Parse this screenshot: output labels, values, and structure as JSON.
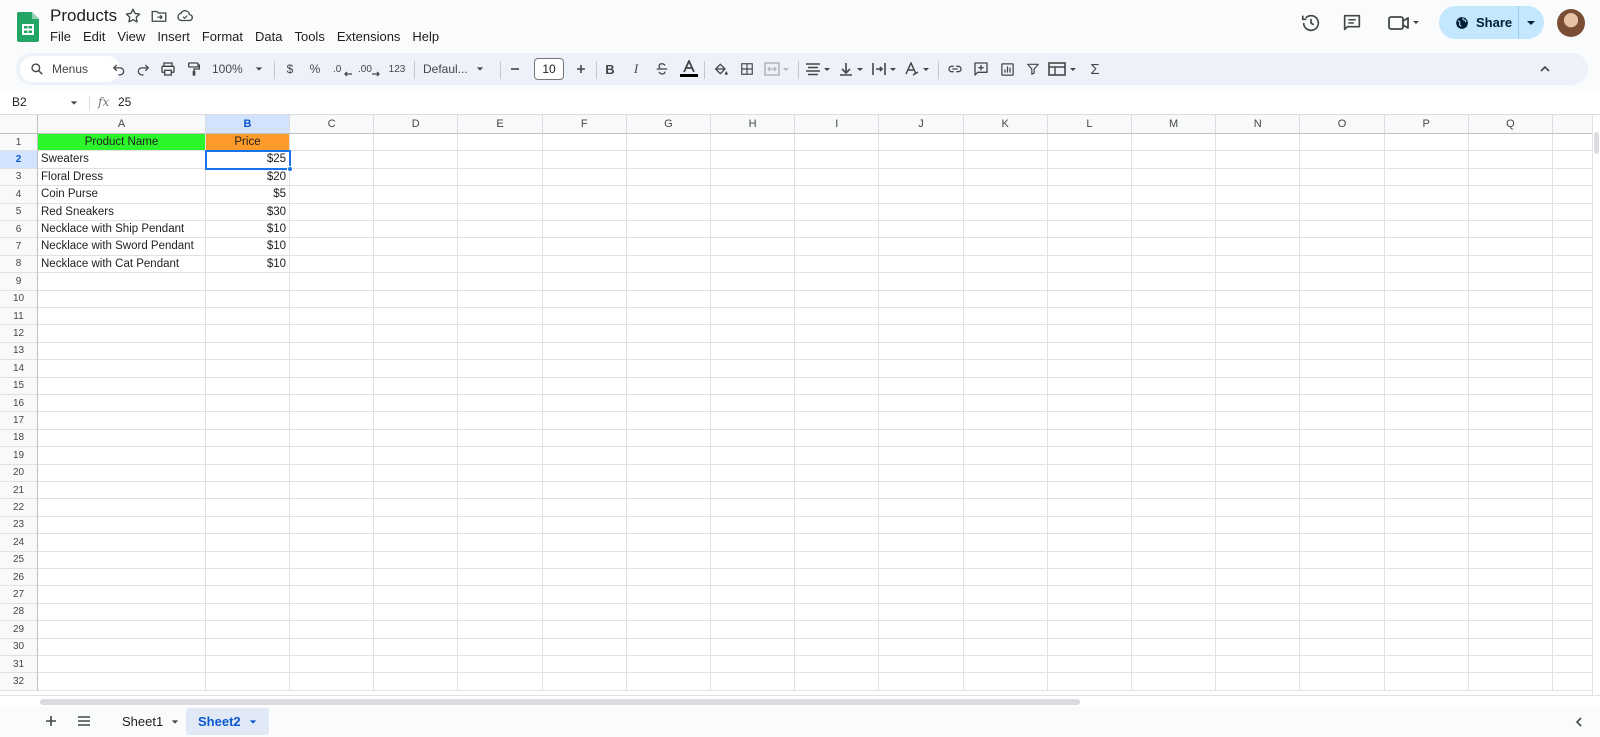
{
  "document": {
    "title": "Products"
  },
  "menu": [
    "File",
    "Edit",
    "View",
    "Insert",
    "Format",
    "Data",
    "Tools",
    "Extensions",
    "Help"
  ],
  "share": {
    "label": "Share"
  },
  "toolbar": {
    "search_placeholder": "Menus",
    "zoom": "100%",
    "currency": "$",
    "percent": "%",
    "decimal_decrease": ".0",
    "decimal_increase": ".00",
    "more_formats": "123",
    "font": "Defaul...",
    "font_size": "10",
    "bold": "B",
    "italic": "I",
    "sigma": "Σ"
  },
  "formula_bar": {
    "cell_ref": "B2",
    "fx": "fx",
    "value": "25"
  },
  "grid": {
    "columns": [
      "A",
      "B",
      "C",
      "D",
      "E",
      "F",
      "G",
      "H",
      "I",
      "J",
      "K",
      "L",
      "M",
      "N",
      "O",
      "P",
      "Q"
    ],
    "row_numbers": [
      "1",
      "2",
      "3",
      "4",
      "5",
      "6",
      "7",
      "8",
      "9",
      "10",
      "11",
      "12",
      "13",
      "14",
      "15",
      "16",
      "17",
      "18",
      "19",
      "20",
      "21",
      "22",
      "23",
      "24",
      "25",
      "26",
      "27",
      "28",
      "29",
      "30",
      "31",
      "32"
    ],
    "headers": [
      "Product Name",
      "Price"
    ],
    "rows": [
      [
        "Sweaters",
        "$25"
      ],
      [
        "Floral Dress",
        "$20"
      ],
      [
        "Coin Purse",
        "$5"
      ],
      [
        "Red Sneakers",
        "$30"
      ],
      [
        "Necklace with Ship Pendant",
        "$10"
      ],
      [
        "Necklace with Sword Pendant",
        "$10"
      ],
      [
        "Necklace with Cat Pendant",
        "$10"
      ]
    ],
    "selected_cell": "B2"
  },
  "colors": {
    "header_a": "#2cf52c",
    "header_b": "#ff9b2a",
    "accent": "#1a73e8",
    "share_bg": "#c2e7ff"
  },
  "sheets": [
    {
      "name": "Sheet1",
      "active": false
    },
    {
      "name": "Sheet2",
      "active": true
    }
  ]
}
